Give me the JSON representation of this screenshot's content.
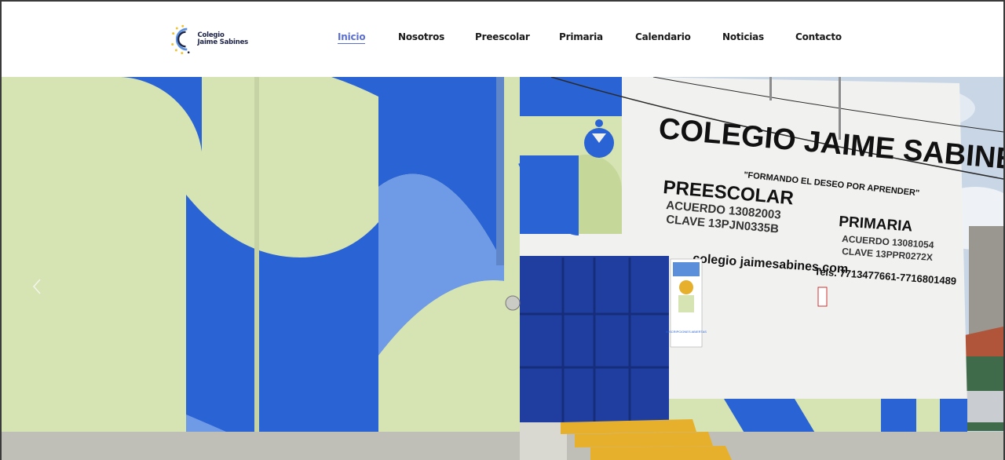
{
  "brand": {
    "line1": "Colegio",
    "line2": "Jaime Sabines",
    "logo_colors": [
      "#f2c230",
      "#1d2346",
      "#5b8fd9"
    ]
  },
  "nav": {
    "items": [
      {
        "label": "Inicio",
        "active": true
      },
      {
        "label": "Nosotros",
        "active": false
      },
      {
        "label": "Preescolar",
        "active": false
      },
      {
        "label": "Primaria",
        "active": false
      },
      {
        "label": "Calendario",
        "active": false
      },
      {
        "label": "Noticias",
        "active": false
      },
      {
        "label": "Contacto",
        "active": false
      }
    ],
    "active_color": "#5b6fd0"
  },
  "hero": {
    "sign": {
      "title": "COLEGIO JAIME SABINES",
      "motto": "\"FORMANDO EL DESEO POR APRENDER\"",
      "pre_title": "PREESCOLAR",
      "pre_acuerdo": "ACUERDO 13082003",
      "pre_clave": "CLAVE 13PJN0335B",
      "pri_title": "PRIMARIA",
      "pri_acuerdo": "ACUERDO 13081054",
      "pri_clave": "CLAVE 13PPR0272X",
      "web": "colegio jaimesabines.com",
      "tel": "Tels. 7713477661-7716801489"
    },
    "poster": {
      "caption": "INSCRIPCIONES ABIERTAS"
    },
    "prev_icon": "chevron-left-icon",
    "colors": {
      "mural_blue": "#2a63d4",
      "mural_light_blue": "#6f9ae6",
      "mural_green": "#d6e3b3",
      "door_blue": "#1f3ea0",
      "wall_white": "#f1f2f0",
      "steps_yellow": "#e7b02c",
      "sky": "#c8d6e6"
    }
  }
}
